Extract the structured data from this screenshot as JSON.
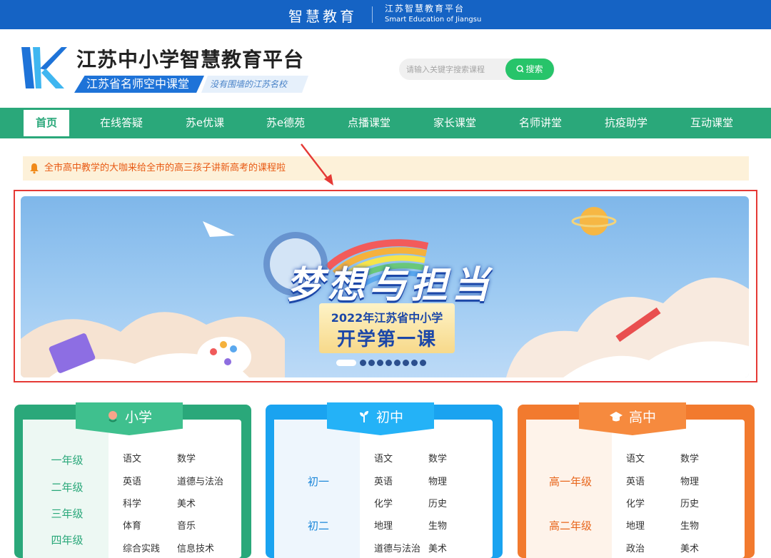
{
  "topbar": {
    "brand": "智慧教育",
    "title_cn": "江苏智慧教育平台",
    "title_en": "Smart Education of Jiangsu"
  },
  "header": {
    "title": "江苏中小学智慧教育平台",
    "subtitle": "江苏省名师空中课堂",
    "slogan": "没有围墙的江苏名校"
  },
  "search": {
    "placeholder": "请输入关键字搜索课程",
    "button": "搜索"
  },
  "nav": {
    "items": [
      "首页",
      "在线答疑",
      "苏e优课",
      "苏e德苑",
      "点播课堂",
      "家长课堂",
      "名师讲堂",
      "抗疫助学",
      "互动课堂"
    ],
    "active": 0
  },
  "notice": {
    "text": "全市高中教学的大咖来给全市的高三孩子讲新高考的课程啦"
  },
  "banner": {
    "title": "梦想与担当",
    "line1": "2022年江苏省中小学",
    "line2": "开学第一课",
    "slides": 9,
    "active_slide": 1
  },
  "colors": {
    "topbar": "#1563c4",
    "nav": "#2aa87a",
    "primary": "#2aa87a",
    "middle": "#1aa3f0",
    "high": "#f27a2e",
    "highlight_box": "#e53935"
  },
  "sections": {
    "primary": {
      "title": "小学",
      "icon": "flower-icon",
      "grades": [
        "一年级",
        "二年级",
        "三年级",
        "四年级"
      ],
      "subjects": [
        "语文",
        "数学",
        "英语",
        "道德与法治",
        "科学",
        "美术",
        "体育",
        "音乐",
        "综合实践",
        "信息技术"
      ]
    },
    "middle": {
      "title": "初中",
      "icon": "sprout-icon",
      "grades": [
        "初一",
        "初二"
      ],
      "subjects": [
        "语文",
        "数学",
        "英语",
        "物理",
        "化学",
        "历史",
        "地理",
        "生物",
        "道德与法治",
        "美术"
      ]
    },
    "high": {
      "title": "高中",
      "icon": "graduation-cap-icon",
      "grades": [
        "高一年级",
        "高二年级"
      ],
      "subjects": [
        "语文",
        "数学",
        "英语",
        "物理",
        "化学",
        "历史",
        "地理",
        "生物",
        "政治",
        "美术"
      ]
    }
  }
}
